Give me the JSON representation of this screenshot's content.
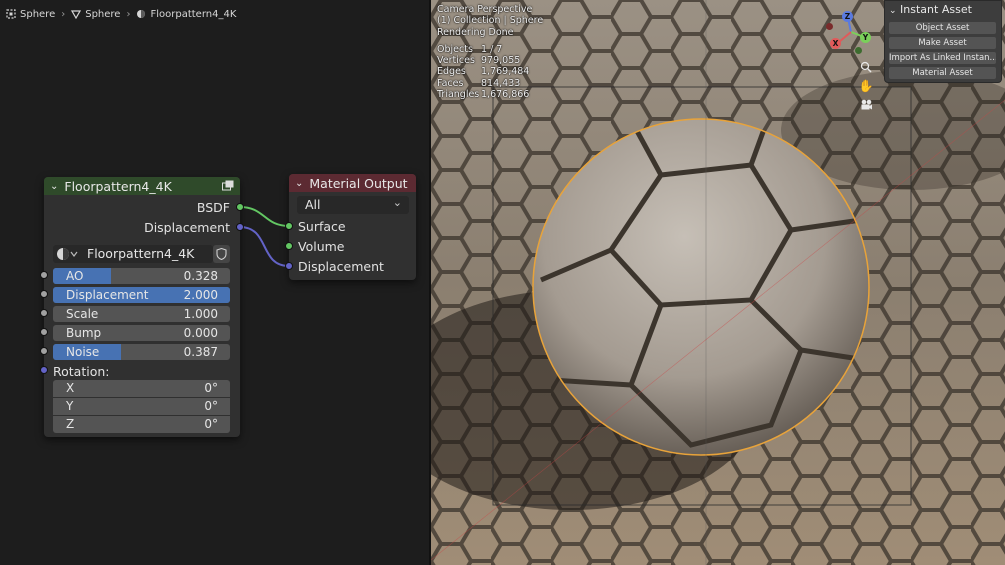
{
  "breadcrumb": {
    "items": [
      {
        "label": "Sphere",
        "icon": "object-icon"
      },
      {
        "label": "Sphere",
        "icon": "mesh-icon"
      },
      {
        "label": "Floorpattern4_4K",
        "icon": "material-icon"
      }
    ]
  },
  "group_node": {
    "title": "Floorpattern4_4K",
    "header_color": "#2f4a2a",
    "outputs": [
      "BSDF",
      "Displacement"
    ],
    "datablock": "Floorpattern4_4K",
    "inputs": [
      {
        "label": "AO",
        "value": "0.328",
        "fill": 0.328
      },
      {
        "label": "Displacement",
        "value": "2.000",
        "fill": 1.0
      },
      {
        "label": "Scale",
        "value": "1.000",
        "fill": 0
      },
      {
        "label": "Bump",
        "value": "0.000",
        "fill": 0
      },
      {
        "label": "Noise",
        "value": "0.387",
        "fill": 0.387
      }
    ],
    "rotation": {
      "label": "Rotation:",
      "components": [
        {
          "axis": "X",
          "value": "0°"
        },
        {
          "axis": "Y",
          "value": "0°"
        },
        {
          "axis": "Z",
          "value": "0°"
        }
      ]
    }
  },
  "output_node": {
    "title": "Material Output",
    "header_color": "#5c2a32",
    "target": "All",
    "inputs": [
      "Surface",
      "Volume",
      "Displacement"
    ]
  },
  "viewport": {
    "overlay": {
      "line1": "Camera Perspective",
      "line2": "(1) Collection | Sphere",
      "line3": "Rendering Done",
      "stats": [
        {
          "k": "Objects",
          "v": "1 / 7"
        },
        {
          "k": "Vertices",
          "v": "979,055"
        },
        {
          "k": "Edges",
          "v": "1,769,484"
        },
        {
          "k": "Faces",
          "v": "814,433"
        },
        {
          "k": "Triangles",
          "v": "1,676,866"
        }
      ]
    },
    "gizmo": {
      "x": "X",
      "y": "Y",
      "z": "Z"
    },
    "panel": {
      "title": "Instant Asset",
      "buttons": [
        "Object Asset",
        "Make Asset",
        "Import As Linked Instan...",
        "Material Asset"
      ]
    }
  },
  "colors": {
    "socket_green": "#63c763",
    "socket_purple": "#6363c7",
    "socket_gray": "#a1a1a1",
    "slider_fill": "#4772b3",
    "selection_outline": "#e8a33a"
  }
}
